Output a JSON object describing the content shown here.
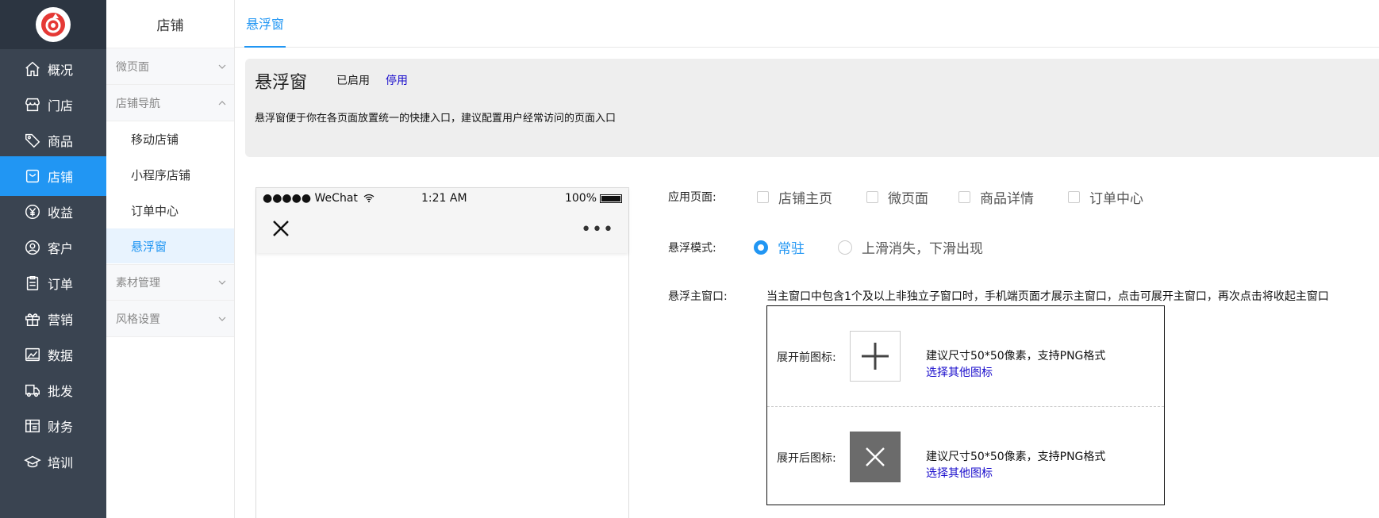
{
  "nav": {
    "items": [
      {
        "label": "概况",
        "icon": "home-icon"
      },
      {
        "label": "门店",
        "icon": "store-icon"
      },
      {
        "label": "商品",
        "icon": "tag-icon"
      },
      {
        "label": "店铺",
        "icon": "shop-bag-icon"
      },
      {
        "label": "收益",
        "icon": "yen-icon"
      },
      {
        "label": "客户",
        "icon": "user-icon"
      },
      {
        "label": "订单",
        "icon": "clipboard-icon"
      },
      {
        "label": "营销",
        "icon": "gift-icon"
      },
      {
        "label": "数据",
        "icon": "chart-icon"
      },
      {
        "label": "批发",
        "icon": "truck-icon"
      },
      {
        "label": "财务",
        "icon": "ledger-icon"
      },
      {
        "label": "培训",
        "icon": "graduation-icon"
      }
    ],
    "active_color": "#2196f3"
  },
  "subnav": {
    "title": "店铺",
    "groups": {
      "micro_page": "微页面",
      "shop_nav": "店铺导航",
      "materials": "素材管理",
      "style": "风格设置"
    },
    "items": [
      "移动店铺",
      "小程序店铺",
      "订单中心",
      "悬浮窗"
    ]
  },
  "tab": {
    "label": "悬浮窗"
  },
  "intro": {
    "title": "悬浮窗",
    "status": "已启用",
    "toggle_link": "停用",
    "desc": "悬浮窗便于你在各页面放置统一的快捷入口，建议配置用户经常访问的页面入口"
  },
  "phone": {
    "carrier": "●●●●● WeChat",
    "time": "1:21 AM",
    "battery": "100%",
    "more": "•••"
  },
  "form": {
    "apply_label": "应用页面:",
    "apply_options": [
      "店铺主页",
      "微页面",
      "商品详情",
      "订单中心"
    ],
    "mode_label": "悬浮模式:",
    "mode_options": [
      "常驻",
      "上滑消失，下滑出现"
    ],
    "main_label": "悬浮主窗口:",
    "main_hint": "当主窗口中包含1个及以上非独立子窗口时，手机端页面才展示主窗口，点击可展开主窗口，再次点击将收起主窗口",
    "before_label": "展开前图标:",
    "after_label": "展开后图标:",
    "size_tip": "建议尺寸50*50像素，支持PNG格式",
    "choose_link": "选择其他图标"
  }
}
